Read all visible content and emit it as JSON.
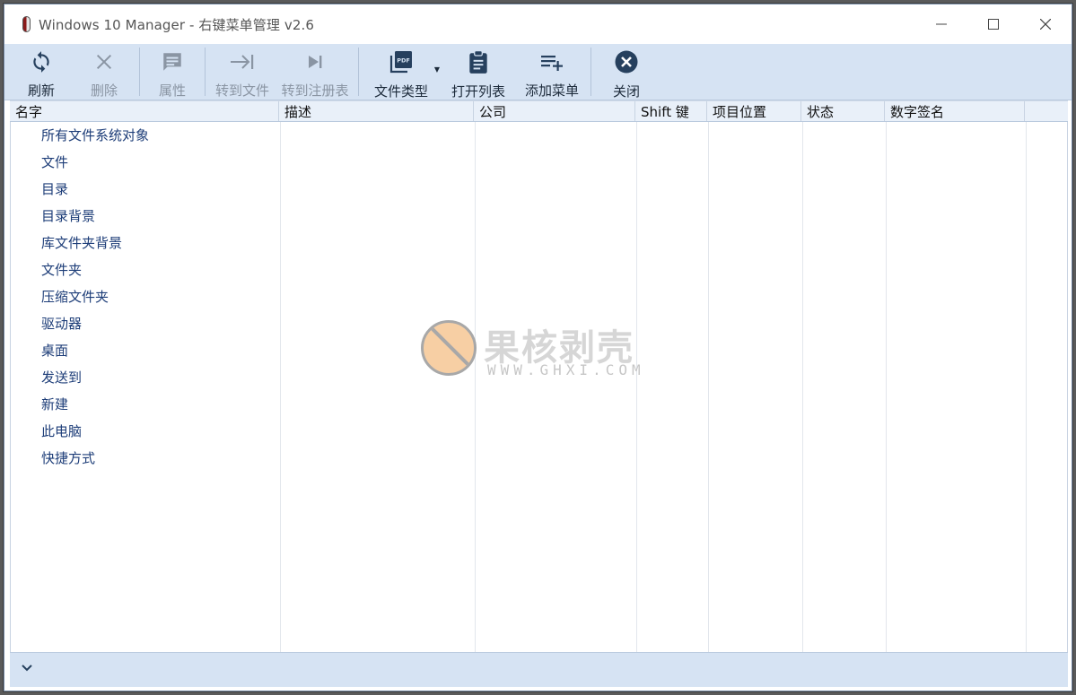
{
  "window": {
    "title": "Windows 10 Manager - 右键菜单管理 v2.6"
  },
  "toolbar": {
    "buttons": [
      {
        "label": "刷新",
        "icon": "refresh-icon",
        "enabled": true
      },
      {
        "label": "删除",
        "icon": "close-x-icon",
        "enabled": false
      },
      {
        "label": "属性",
        "icon": "comment-icon",
        "enabled": false
      },
      {
        "label": "转到文件",
        "icon": "arrow-to-bar-icon",
        "enabled": false
      },
      {
        "label": "转到注册表",
        "icon": "skip-next-icon",
        "enabled": false
      },
      {
        "label": "文件类型",
        "icon": "pdf-file-icon",
        "enabled": true,
        "has_dropdown": true
      },
      {
        "label": "打开列表",
        "icon": "clipboard-list-icon",
        "enabled": true
      },
      {
        "label": "添加菜单",
        "icon": "playlist-add-icon",
        "enabled": true
      },
      {
        "label": "关闭",
        "icon": "close-circle-icon",
        "enabled": true
      }
    ]
  },
  "columns": [
    "名字",
    "描述",
    "公司",
    "Shift 键",
    "项目位置",
    "状态",
    "数字签名"
  ],
  "items": [
    "所有文件系统对象",
    "文件",
    "目录",
    "目录背景",
    "库文件夹背景",
    "文件夹",
    "压缩文件夹",
    "驱动器",
    "桌面",
    "发送到",
    "新建",
    "此电脑",
    "快捷方式"
  ],
  "watermark": {
    "cn": "果核剥壳",
    "en": "WWW.GHXI.COM"
  },
  "colors": {
    "toolbar_bg": "#d6e3f3",
    "item_text": "#1d3d78",
    "header_bg": "#e9f0f9"
  }
}
